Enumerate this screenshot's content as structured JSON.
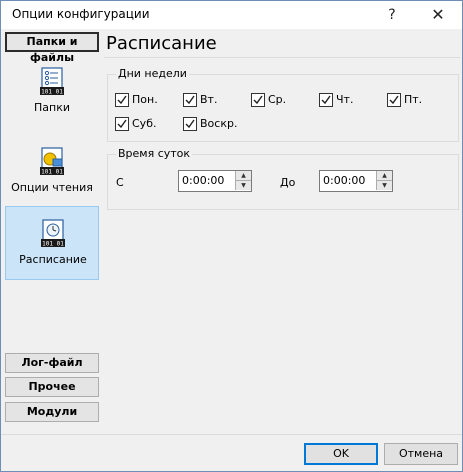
{
  "window": {
    "title": "Опции конфигурации",
    "help_label": "?",
    "close_label": "✕"
  },
  "sidebar": {
    "top_button": "Папки и файлы",
    "items": [
      {
        "label": "Папки",
        "icon": "folder-list-icon"
      },
      {
        "label": "Опции чтения",
        "icon": "read-options-icon"
      },
      {
        "label": "Расписание",
        "icon": "clock-schedule-icon"
      }
    ],
    "bottom_buttons": [
      "Лог-файл",
      "Прочее",
      "Модули"
    ]
  },
  "page": {
    "title": "Расписание",
    "weekdays_group": {
      "legend": "Дни недели",
      "days": [
        {
          "label": "Пон.",
          "checked": true
        },
        {
          "label": "Вт.",
          "checked": true
        },
        {
          "label": "Ср.",
          "checked": true
        },
        {
          "label": "Чт.",
          "checked": true
        },
        {
          "label": "Пт.",
          "checked": true
        },
        {
          "label": "Суб.",
          "checked": true
        },
        {
          "label": "Воскр.",
          "checked": true
        }
      ]
    },
    "time_group": {
      "legend": "Время суток",
      "from_label": "С",
      "from_value": "0:00:00",
      "to_label": "До",
      "to_value": "0:00:00"
    }
  },
  "footer": {
    "ok_label": "OK",
    "cancel_label": "Отмена"
  }
}
